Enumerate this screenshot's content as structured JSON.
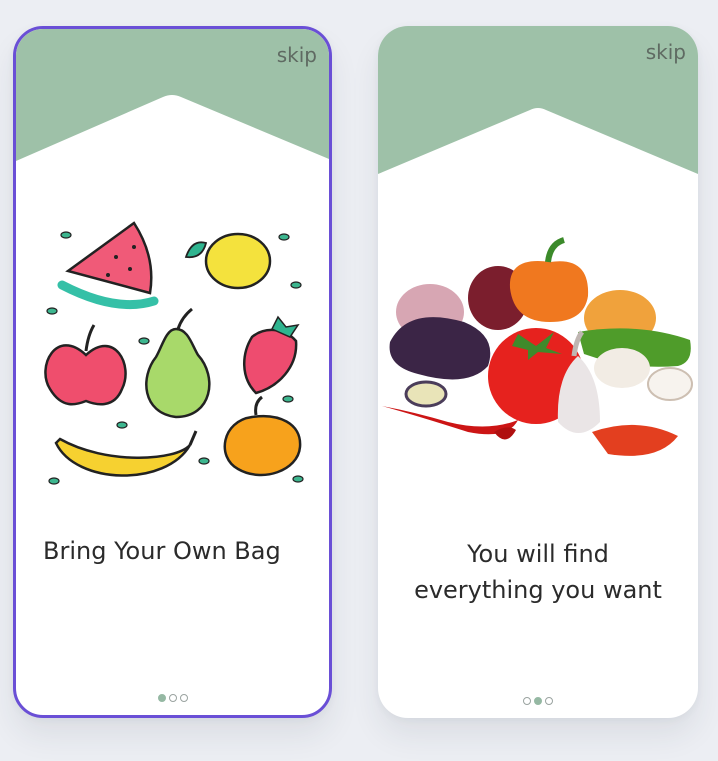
{
  "colors": {
    "header_green": "#9ec1a8",
    "accent_purple": "#6a4fd6",
    "dot_active": "#95b8a3"
  },
  "screens": [
    {
      "skip_label": "skip",
      "title": "Bring Your Own Bag",
      "illustration": "fruits-illustration",
      "dots": {
        "count": 3,
        "active": 1
      }
    },
    {
      "skip_label": "skip",
      "title_line1": "You will find",
      "title_line2": "everything you want",
      "illustration": "vegetables-illustration",
      "dots": {
        "count": 3,
        "active": 2
      }
    }
  ]
}
